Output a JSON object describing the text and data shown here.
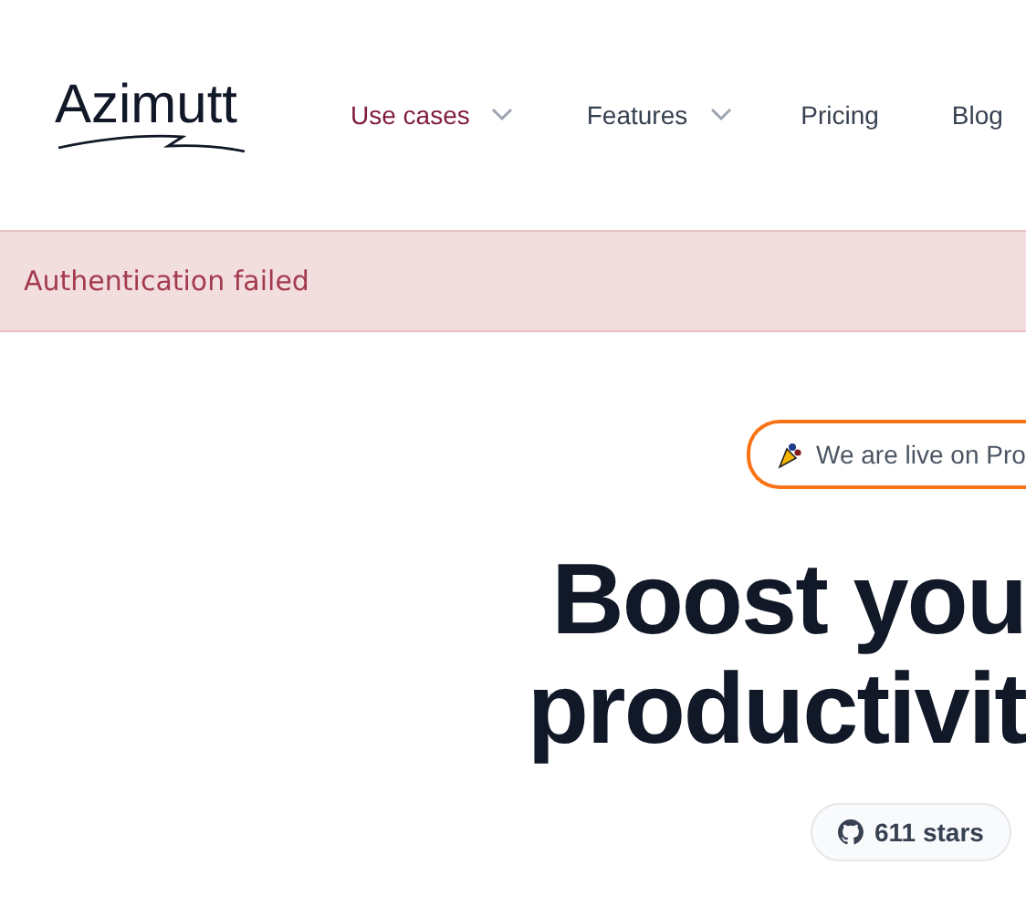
{
  "header": {
    "logo": "Azimutt",
    "nav": [
      {
        "label": "Use cases",
        "dropdown": true
      },
      {
        "label": "Features",
        "dropdown": true
      },
      {
        "label": "Pricing",
        "dropdown": false
      },
      {
        "label": "Blog",
        "dropdown": false
      }
    ]
  },
  "alert": {
    "message": "Authentication failed"
  },
  "hero": {
    "announcement": "We are live on Pro",
    "title_lines": [
      "Boost you",
      "productivit"
    ],
    "stars": "611 stars"
  }
}
